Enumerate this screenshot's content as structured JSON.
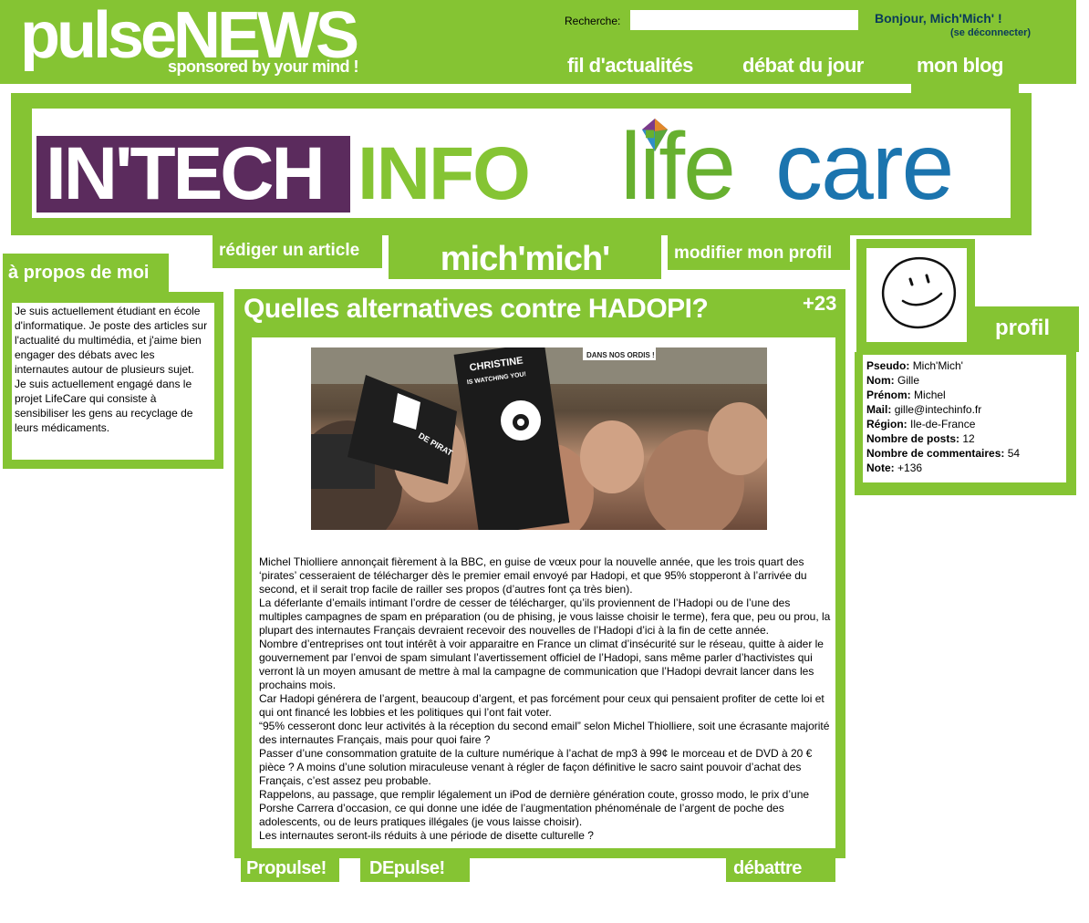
{
  "brand": {
    "logo": "pulseNEWS",
    "tagline": "sponsored by your mind !"
  },
  "search": {
    "label": "Recherche:",
    "value": ""
  },
  "user": {
    "greeting": "Bonjour, Mich'Mich' !",
    "logout": "(se déconnecter)"
  },
  "nav": {
    "feed": "fil d'actualités",
    "debate": "débat du jour",
    "blog": "mon blog"
  },
  "banner": {
    "intech": "IN'TECH",
    "info": "INFO",
    "life": "life",
    "care": "care"
  },
  "about": {
    "title": "à propos de moi",
    "paragraphs": [
      "Je suis actuellement étudiant en école d'informatique. Je poste des articles sur l'actualité du multimédia, et j'aime bien engager des débats avec les internautes autour de plusieurs sujet.",
      "Je suis actuellement engagé dans le projet LifeCare qui consiste à sensibiliser les gens au recyclage de leurs médicaments."
    ]
  },
  "tabs": {
    "write": "rédiger un article",
    "username": "mich'mich'",
    "edit_profile": "modifier mon profil"
  },
  "article": {
    "title": "Quelles alternatives contre HADOPI?",
    "score": "+23",
    "image_texts": {
      "sign_top": "CHRISTINE",
      "sign_sub": "IS WATCHING YOU!",
      "banner_right": "DANS NOS ORDIS !",
      "flag": "DE PIRAT"
    },
    "paragraphs": [
      "Michel Thiolliere annonçait fièrement à la BBC, en guise de vœux pour la nouvelle année, que les trois quart des ‘pirates’ cesseraient de télécharger dès le premier email envoyé par Hadopi, et que 95% stopperont à l’arrivée du second, et il serait trop facile de railler ses propos (d’autres font ça très bien).",
      "La déferlante d’emails intimant l’ordre de cesser de télécharger, qu’ils proviennent de l’Hadopi ou de l’une des multiples campagnes de spam en préparation (ou de phising, je vous laisse choisir le terme), fera que, peu ou prou, la plupart des internautes Français devraient recevoir des nouvelles de l’Hadopi d’ici à la fin de cette année.",
      "Nombre d’entreprises ont tout intérêt à voir apparaitre en France un climat d’insécurité sur le réseau, quitte à aider le gouvernement par l’envoi de spam simulant l’avertissement officiel de l’Hadopi, sans même parler d’hactivistes qui verront là un moyen amusant de mettre à mal la campagne de communication que l’Hadopi devrait lancer dans les prochains mois.",
      "Car Hadopi générera de l’argent, beaucoup d’argent, et pas forcément pour ceux qui pensaient profiter de cette loi et qui ont financé les lobbies et les politiques qui l’ont fait voter.",
      "“95% cesseront donc leur activités à la réception du second email” selon Michel Thiolliere, soit une écrasante majorité des internautes Français, mais pour quoi faire ?",
      "Passer d’une consommation gratuite de la culture numérique à l’achat de mp3 à 99¢ le morceau et de DVD à 20 € pièce ? A moins d’une solution miraculeuse venant à régler de façon définitive le sacro saint pouvoir d’achat des Français, c’est assez peu probable.",
      "Rappelons, au passage, que remplir légalement un iPod de dernière génération coute, grosso modo, le prix d’une Porshe Carrera d’occasion, ce qui donne une idée de l’augmentation phénoménale de l’argent de poche des adolescents, ou de leurs pratiques illégales (je vous laisse choisir).",
      "Les internautes seront-ils réduits à une période de disette culturelle ?"
    ]
  },
  "actions": {
    "propulse": "Propulse!",
    "depulse": "DEpulse!",
    "debate": "débattre"
  },
  "profile": {
    "title": "profil",
    "fields": [
      {
        "label": "Pseudo:",
        "value": "Mich'Mich'"
      },
      {
        "label": "Nom:",
        "value": "Gille"
      },
      {
        "label": "Prénom:",
        "value": "Michel"
      },
      {
        "label": "Mail:",
        "value": "gille@intechinfo.fr"
      },
      {
        "label": "Région:",
        "value": "Ile-de-France"
      },
      {
        "label": "Nombre de posts:",
        "value": "12"
      },
      {
        "label": "Nombre de commentaires:",
        "value": "54"
      },
      {
        "label": "Note:",
        "value": "+136"
      }
    ]
  },
  "colors": {
    "green": "#85c433",
    "purple": "#5b2b5d",
    "blue": "#1b74ae"
  }
}
